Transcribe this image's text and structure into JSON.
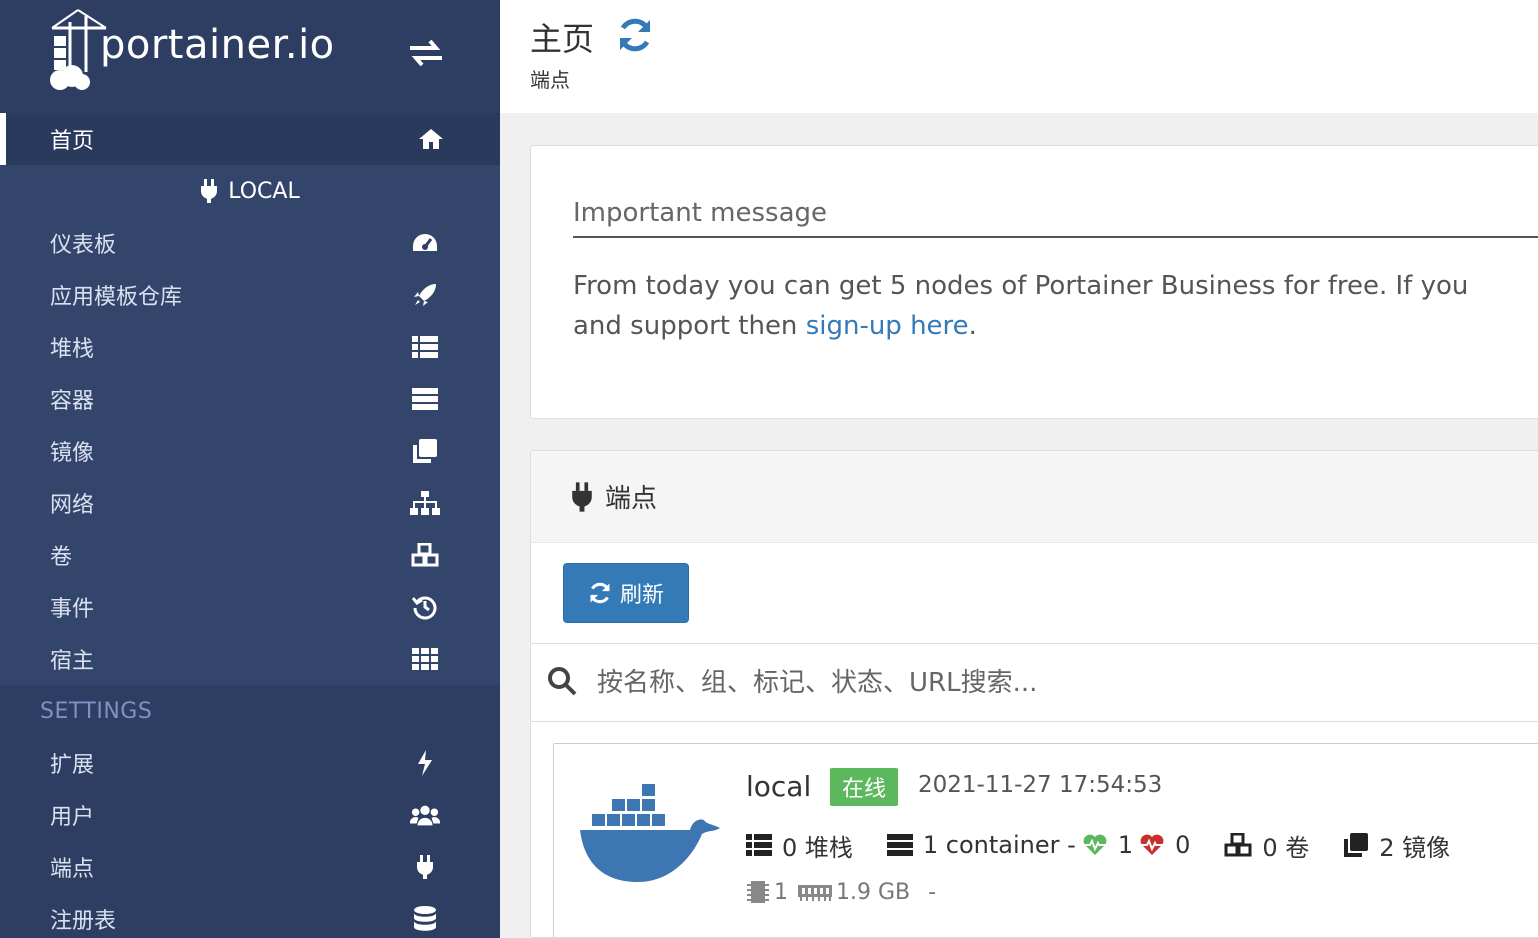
{
  "brand": {
    "logo_text": "portainer.io"
  },
  "sidebar": {
    "home_label": "首页",
    "env_name": "LOCAL",
    "items": [
      {
        "label": "仪表板",
        "icon": "tachometer-icon"
      },
      {
        "label": "应用模板仓库",
        "icon": "rocket-icon"
      },
      {
        "label": "堆栈",
        "icon": "th-list-icon"
      },
      {
        "label": "容器",
        "icon": "server-icon"
      },
      {
        "label": "镜像",
        "icon": "clone-icon"
      },
      {
        "label": "网络",
        "icon": "sitemap-icon"
      },
      {
        "label": "卷",
        "icon": "cubes-icon"
      },
      {
        "label": "事件",
        "icon": "history-icon"
      },
      {
        "label": "宿主",
        "icon": "th-icon"
      }
    ],
    "settings_title": "SETTINGS",
    "settings_items": [
      {
        "label": "扩展",
        "icon": "bolt-icon"
      },
      {
        "label": "用户",
        "icon": "users-icon"
      },
      {
        "label": "端点",
        "icon": "plug-icon"
      },
      {
        "label": "注册表",
        "icon": "database-icon"
      }
    ]
  },
  "header": {
    "title": "主页",
    "subtitle": "端点"
  },
  "message": {
    "title": "Important message",
    "body_line1": "From today you can get 5 nodes of Portainer Business for free. If you",
    "body_line2_prefix": "and support then ",
    "link_text": "sign-up here",
    "body_line2_suffix": "."
  },
  "endpoints": {
    "title": "端点",
    "refresh_label": "刷新",
    "search_placeholder": "按名称、组、标记、状态、URL搜索...",
    "items": [
      {
        "name": "local",
        "status": "在线",
        "timestamp": "2021-11-27 17:54:53",
        "stacks": "0 堆栈",
        "containers": "1 container -",
        "healthy": "1",
        "unhealthy": "0",
        "volumes": "0 卷",
        "images": "2 镜像",
        "cpu": "1",
        "memory": "1.9 GB",
        "dash": "-"
      }
    ]
  },
  "colors": {
    "sidebar": "#2e3e63",
    "accent": "#337ab7",
    "online": "#5cb85c",
    "healthy": "#5cb85c",
    "unhealthy": "#c9302c"
  }
}
